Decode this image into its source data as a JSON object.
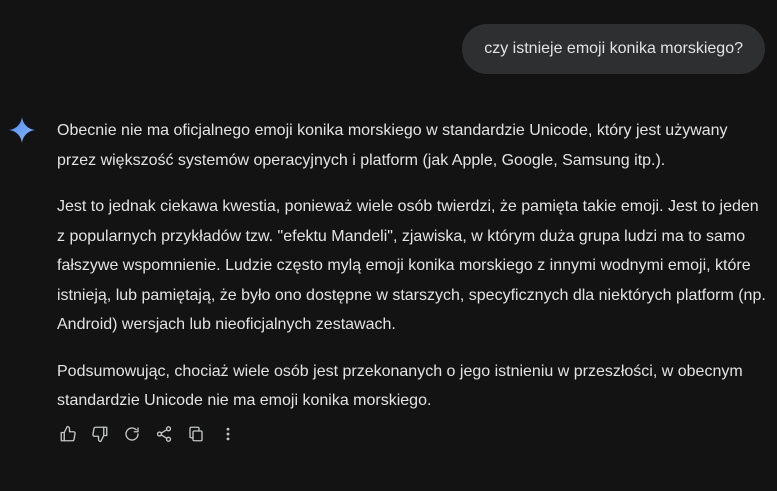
{
  "user_message": {
    "text": "czy istnieje emoji konika morskiego?"
  },
  "response": {
    "paragraphs": [
      "Obecnie nie ma oficjalnego emoji konika morskiego w standardzie Unicode, który jest używany przez większość systemów operacyjnych i platform (jak Apple, Google, Samsung itp.).",
      "Jest to jednak ciekawa kwestia, ponieważ wiele osób twierdzi, że pamięta takie emoji. Jest to jeden z popularnych przykładów tzw. \"efektu Mandeli\", zjawiska, w którym duża grupa ludzi ma to samo fałszywe wspomnienie. Ludzie często mylą emoji konika morskiego z innymi wodnymi emoji, które istnieją, lub pamiętają, że było ono dostępne w starszych, specyficznych dla niektórych platform (np. Android) wersjach lub nieoficjalnych zestawach.",
      "Podsumowując, chociaż wiele osób jest przekonanych o jego istnieniu w przeszłości, w obecnym standardzie Unicode nie ma emoji konika morskiego."
    ]
  },
  "actions": [
    {
      "name": "thumb-up-icon"
    },
    {
      "name": "thumb-down-icon"
    },
    {
      "name": "regenerate-icon"
    },
    {
      "name": "share-icon"
    },
    {
      "name": "copy-icon"
    },
    {
      "name": "more-options-icon"
    }
  ],
  "colors": {
    "background": "#131314",
    "user_bubble": "#2e2f31",
    "text": "#e3e3e3",
    "icon": "#c4c7c5",
    "sparkle_start": "#4e8cf7",
    "sparkle_end": "#8ab4f8"
  }
}
